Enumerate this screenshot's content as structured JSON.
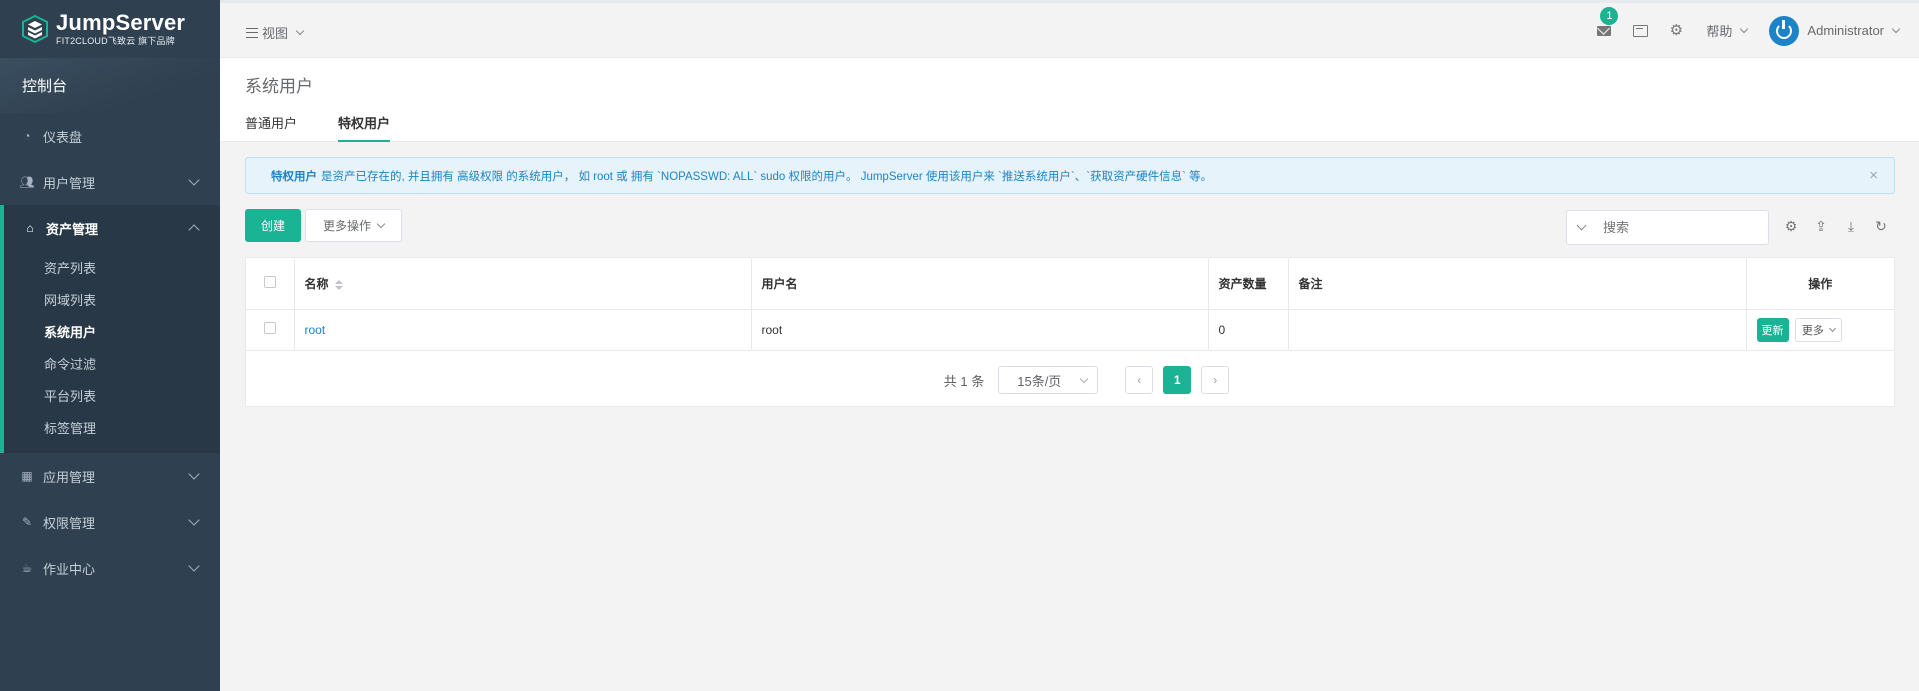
{
  "brand": {
    "title": "JumpServer",
    "subtitle": "FIT2CLOUD飞致云 旗下品牌"
  },
  "sidebar": {
    "console_label": "控制台",
    "items": [
      {
        "label": "仪表盘",
        "icon": "dashboard-icon"
      },
      {
        "label": "用户管理",
        "icon": "users-icon"
      },
      {
        "label": "资产管理",
        "icon": "inbox-icon",
        "expanded": true,
        "children": [
          "资产列表",
          "网域列表",
          "系统用户",
          "命令过滤",
          "平台列表",
          "标签管理"
        ],
        "active_child": "系统用户"
      },
      {
        "label": "应用管理",
        "icon": "grid-icon"
      },
      {
        "label": "权限管理",
        "icon": "edit-icon"
      },
      {
        "label": "作业中心",
        "icon": "coffee-icon"
      }
    ]
  },
  "topbar": {
    "view_label": "视图",
    "notification_count": "1",
    "help_label": "帮助",
    "user_name": "Administrator"
  },
  "page": {
    "title": "系统用户",
    "tabs": [
      {
        "label": "普通用户",
        "active": false
      },
      {
        "label": "特权用户",
        "active": true
      }
    ]
  },
  "alert": {
    "bold": "特权用户",
    "text": "是资产已存在的, 并且拥有 高级权限 的系统用户， 如 root 或 拥有 `NOPASSWD: ALL` sudo 权限的用户。 JumpServer 使用该用户来 `推送系统用户`、`获取资产硬件信息` 等。",
    "close": "×"
  },
  "toolbar": {
    "create_label": "创建",
    "more_label": "更多操作",
    "search_placeholder": "搜索"
  },
  "table": {
    "headers": [
      "名称",
      "用户名",
      "资产数量",
      "备注",
      "操作"
    ],
    "rows": [
      {
        "name": "root",
        "username": "root",
        "asset_count": "0",
        "comment": "",
        "update_label": "更新",
        "more_label": "更多"
      }
    ]
  },
  "pagination": {
    "total": "共 1 条",
    "page_size": "15条/页",
    "prev": "‹",
    "current": "1",
    "next": "›"
  },
  "colors": {
    "accent": "#1ab394",
    "sidebar": "#2f4050",
    "link": "#1c84c6"
  }
}
